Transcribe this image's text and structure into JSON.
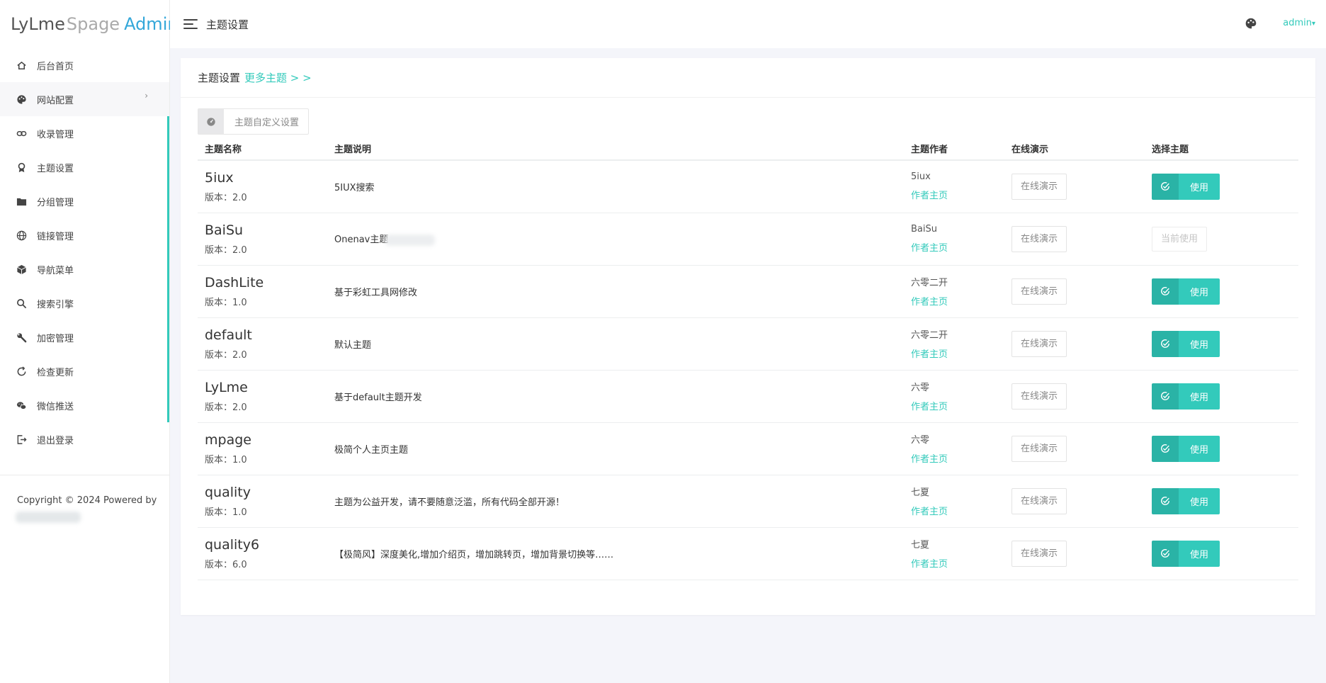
{
  "logo": {
    "part1": "LyLme",
    "part2": "Spage",
    "part3": "Admin"
  },
  "sidebar": {
    "items": [
      {
        "label": "后台首页",
        "icon": "home-icon"
      },
      {
        "label": "网站配置",
        "icon": "palette-icon",
        "chevron": "›"
      },
      {
        "label": "收录管理",
        "icon": "link-icon"
      },
      {
        "label": "主题设置",
        "icon": "award-icon"
      },
      {
        "label": "分组管理",
        "icon": "folder-icon"
      },
      {
        "label": "链接管理",
        "icon": "globe-icon"
      },
      {
        "label": "导航菜单",
        "icon": "box-icon"
      },
      {
        "label": "搜索引擎",
        "icon": "search-icon"
      },
      {
        "label": "加密管理",
        "icon": "wrench-icon"
      },
      {
        "label": "检查更新",
        "icon": "refresh-icon"
      },
      {
        "label": "微信推送",
        "icon": "wechat-icon"
      },
      {
        "label": "退出登录",
        "icon": "logout-icon"
      }
    ],
    "copyright": "Copyright © 2024 Powered by"
  },
  "topbar": {
    "title": "主题设置",
    "user": "admin",
    "caret": "▾"
  },
  "card": {
    "title": "主题设置",
    "more_link": "更多主题 > >",
    "custom_button": "主题自定义设置",
    "columns": [
      "主题名称",
      "主题说明",
      "主题作者",
      "在线演示",
      "选择主题"
    ],
    "version_prefix": "版本：",
    "demo_label": "在线演示",
    "author_link": "作者主页",
    "use_label": "使用",
    "current_label": "当前使用",
    "rows": [
      {
        "name": "5iux",
        "version": "版本：2.0",
        "desc": "5IUX搜索",
        "author": "5iux",
        "current": false
      },
      {
        "name": "BaiSu",
        "version": "版本：2.0",
        "desc": "Onenav主题",
        "author": "BaiSu",
        "current": true
      },
      {
        "name": "DashLite",
        "version": "版本：1.0",
        "desc": "基于彩虹工具网修改",
        "author": "六零二开",
        "current": false
      },
      {
        "name": "default",
        "version": "版本：2.0",
        "desc": "默认主题",
        "author": "六零二开",
        "current": false
      },
      {
        "name": "LyLme",
        "version": "版本：2.0",
        "desc": "基于default主题开发",
        "author": "六零",
        "current": false
      },
      {
        "name": "mpage",
        "version": "版本：1.0",
        "desc": "极简个人主页主题",
        "author": "六零",
        "current": false
      },
      {
        "name": "quality",
        "version": "版本：1.0",
        "desc": "主题为公益开发，请不要随意泛滥，所有代码全部开源！",
        "author": "七夏",
        "current": false
      },
      {
        "name": "quality6",
        "version": "版本：6.0",
        "desc": "【极简风】深度美化,增加介绍页，增加跳转页，增加背景切换等……",
        "author": "七夏",
        "current": false
      }
    ]
  },
  "colors": {
    "accent": "#33cabb",
    "accent_dark": "#2ab3a6",
    "logo_blue": "#33a7d9"
  }
}
